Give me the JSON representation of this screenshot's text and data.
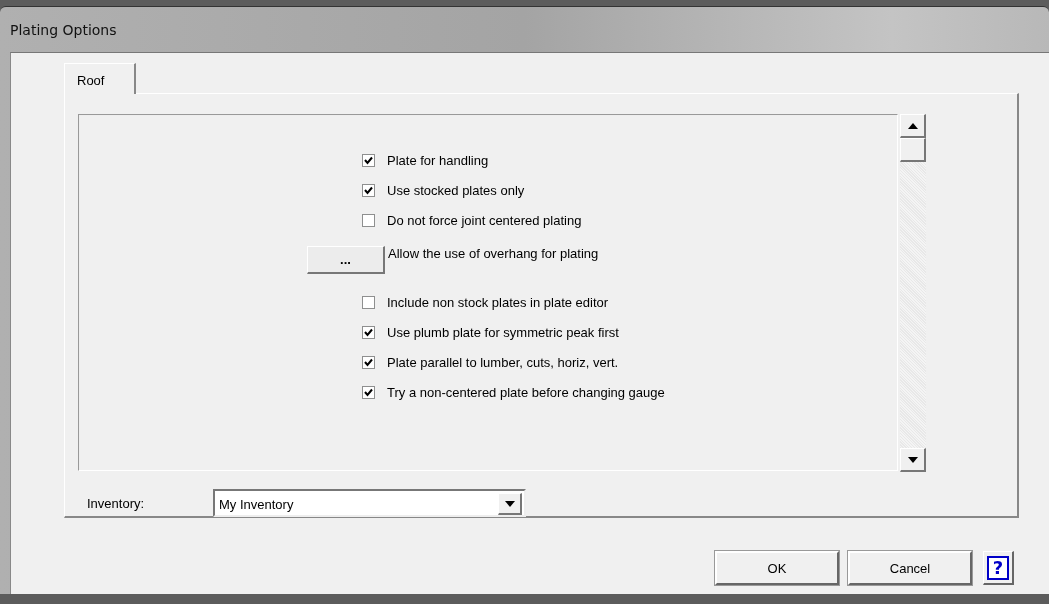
{
  "window": {
    "title": "Plating Options"
  },
  "tabs": [
    {
      "label": "Roof",
      "selected": true
    }
  ],
  "options": [
    {
      "kind": "checkbox",
      "label": "Plate for handling",
      "checked": true
    },
    {
      "kind": "checkbox",
      "label": "Use stocked plates only",
      "checked": true
    },
    {
      "kind": "checkbox",
      "label": "Do not force joint centered plating",
      "checked": false
    },
    {
      "kind": "button",
      "button": "...",
      "label": "Allow the use of overhang for plating"
    },
    {
      "kind": "checkbox",
      "label": "Include non stock plates in plate editor",
      "checked": false
    },
    {
      "kind": "checkbox",
      "label": "Use plumb plate for symmetric peak first",
      "checked": true
    },
    {
      "kind": "checkbox",
      "label": "Plate parallel to lumber, cuts, horiz, vert.",
      "checked": true
    },
    {
      "kind": "checkbox",
      "label": "Try a non-centered plate before changing gauge",
      "checked": true
    }
  ],
  "inventory": {
    "label": "Inventory:",
    "value": "My Inventory"
  },
  "buttons": [
    {
      "kind": "push",
      "label": "OK"
    },
    {
      "kind": "push",
      "label": "Cancel"
    },
    {
      "kind": "help",
      "label": "?"
    }
  ]
}
